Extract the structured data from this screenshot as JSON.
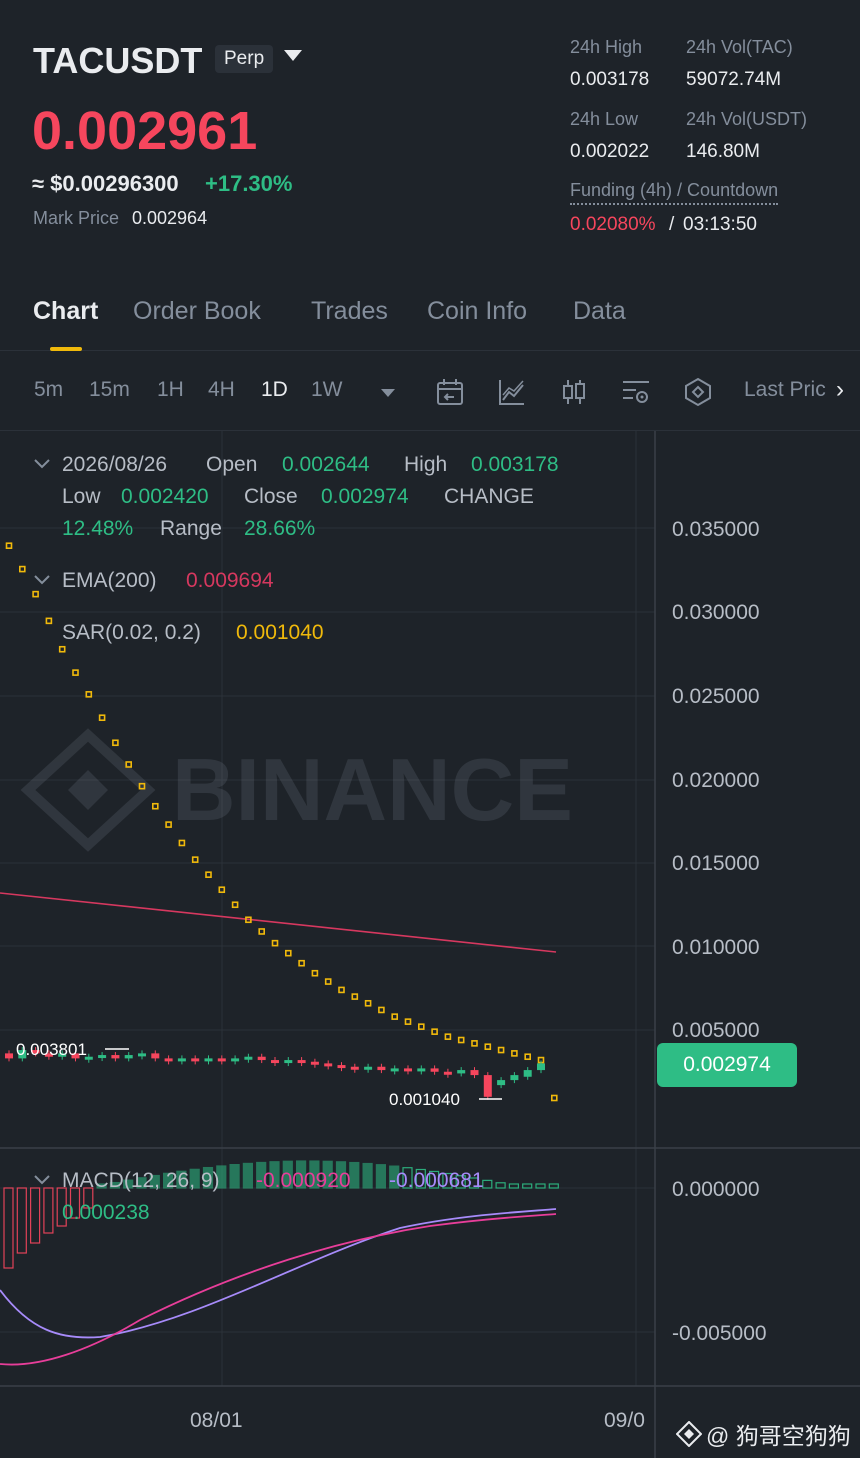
{
  "header": {
    "symbol": "TACUSDT",
    "contract_type": "Perp",
    "last_price": "0.002961",
    "usd_price": "≈ $0.00296300",
    "change_pct": "+17.30%",
    "mark_price_label": "Mark Price",
    "mark_price": "0.002964"
  },
  "stats": {
    "high_label": "24h High",
    "high_value": "0.003178",
    "vol_base_label": "24h Vol(TAC)",
    "vol_base_value": "59072.74M",
    "low_label": "24h Low",
    "low_value": "0.002022",
    "vol_quote_label": "24h Vol(USDT)",
    "vol_quote_value": "146.80M",
    "funding_label": "Funding (4h) / Countdown",
    "funding_rate": "0.02080%",
    "funding_sep": "/",
    "countdown": "03:13:50"
  },
  "tabs": [
    {
      "label": "Chart",
      "active": true
    },
    {
      "label": "Order Book"
    },
    {
      "label": "Trades"
    },
    {
      "label": "Coin Info"
    },
    {
      "label": "Data"
    }
  ],
  "toolbar": {
    "timeframes": [
      "5m",
      "15m",
      "1H",
      "4H",
      "1D",
      "1W"
    ],
    "active_timeframe": "1D",
    "price_type": "Last Pric",
    "icons": [
      "calendar-back-icon",
      "indicator-line-icon",
      "candle-style-icon",
      "settings-icon",
      "depth-icon"
    ]
  },
  "legend": {
    "date": "2026/08/26",
    "open_label": "Open",
    "open": "0.002644",
    "high_label": "High",
    "high": "0.003178",
    "low_label": "Low",
    "low": "0.002420",
    "close_label": "Close",
    "close": "0.002974",
    "change_label": "CHANGE",
    "change": "12.48%",
    "range_label": "Range",
    "range": "28.66%",
    "ema_label": "EMA(200)",
    "ema_value": "0.009694",
    "sar_label": "SAR(0.02, 0.2)",
    "sar_value": "0.001040",
    "macd_label": "MACD(12, 26, 9)",
    "macd_value": "-0.000920",
    "macd_signal": "-0.000681",
    "macd_hist": "0.000238"
  },
  "price_axis": [
    "0.035000",
    "0.030000",
    "0.025000",
    "0.020000",
    "0.015000",
    "0.010000",
    "0.005000"
  ],
  "macd_axis": [
    "0.000000",
    "-0.005000"
  ],
  "time_axis": [
    "08/01",
    "09/0"
  ],
  "annotations": {
    "high_marker": "0.003801",
    "low_marker": "0.001040",
    "current_price_tag": "0.002974"
  },
  "watermark_text": "BINANCE",
  "credit": "@ 狗哥空狗狗",
  "colors": {
    "background": "#1e2329",
    "up": "#2ebd85",
    "down": "#f6465d",
    "sar": "#f0b90b",
    "ema": "#d6385f",
    "macd_line": "#a78bfa",
    "signal_line": "#e83e9a"
  },
  "chart_data": {
    "type": "candlestick",
    "ema200": {
      "start": 0.0133,
      "end": 0.009694
    },
    "sar_points": [
      0.034,
      0.0326,
      0.0311,
      0.0295,
      0.0278,
      0.0264,
      0.0251,
      0.0237,
      0.0222,
      0.0209,
      0.0196,
      0.0184,
      0.0173,
      0.0162,
      0.0152,
      0.0143,
      0.0134,
      0.0125,
      0.0116,
      0.0109,
      0.0102,
      0.0096,
      0.009,
      0.0084,
      0.0079,
      0.0074,
      0.007,
      0.0066,
      0.0062,
      0.0058,
      0.0055,
      0.0052,
      0.0049,
      0.0046,
      0.0044,
      0.0042,
      0.004,
      0.0038,
      0.0036,
      0.0034,
      0.0032,
      0.000104
    ]
  }
}
